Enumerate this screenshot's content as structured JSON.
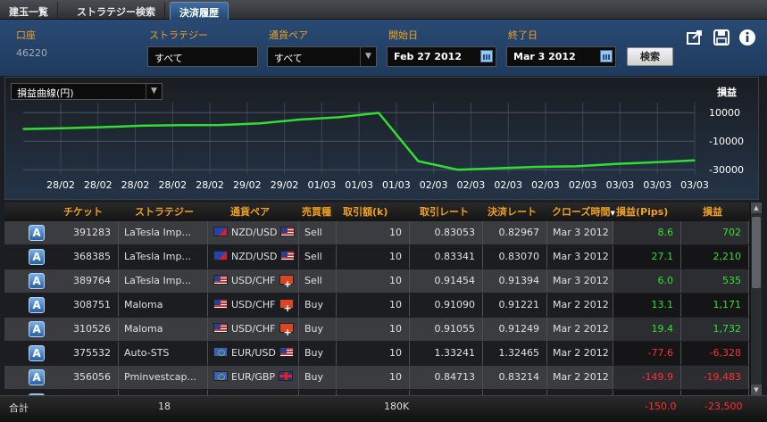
{
  "tabs": [
    {
      "label": "建玉一覧",
      "active": false
    },
    {
      "label": "ストラテジー検索",
      "active": false
    },
    {
      "label": "決済履歴",
      "active": true
    }
  ],
  "filter": {
    "account_label": "口座",
    "account_value": "46220",
    "strategy_label": "ストラテジー",
    "strategy_value": "すべて",
    "pair_label": "通貨ペア",
    "pair_value": "すべて",
    "start_label": "開始日",
    "start_value": "Feb 27 2012",
    "end_label": "終了日",
    "end_value": "Mar 3 2012",
    "search_button": "検索"
  },
  "toolbar_icons": [
    "export-icon",
    "save-icon",
    "info-icon"
  ],
  "chart_select": "損益曲線(円)",
  "chart_right_label": "損益",
  "chart_data": {
    "type": "line",
    "x": [
      "28/02",
      "28/02",
      "28/02",
      "28/02",
      "28/02",
      "29/02",
      "29/02",
      "01/03",
      "01/03",
      "01/03",
      "02/03",
      "02/03",
      "02/03",
      "02/03",
      "02/03",
      "03/03",
      "03/03",
      "03/03"
    ],
    "series": [
      {
        "values": [
          -1500,
          -1000,
          -200,
          800,
          1200,
          1300,
          2500,
          5100,
          6800,
          9800,
          -24000,
          -30000,
          -29000,
          -28000,
          -27600,
          -26000,
          -24800,
          -23500
        ]
      }
    ],
    "yticks": [
      10000,
      -10000,
      -30000
    ],
    "ylim": [
      -33000,
      17000
    ],
    "line_color": "#33dd33",
    "grid": true
  },
  "table": {
    "headers": [
      "チケット",
      "ストラテジー",
      "通貨ペア",
      "売買種",
      "取引額(k)",
      "取引レート",
      "決済レート",
      "クローズ時間",
      "損益(Pips)",
      "損益"
    ],
    "sort_column": "クローズ時間",
    "rows": [
      {
        "icon": "A",
        "ticket": "391283",
        "strategy": "LaTesla Imp...",
        "pair": "NZD/USD",
        "f1": "nzd",
        "f2": "usd",
        "side": "Sell",
        "amount": "10",
        "rate": "0.83053",
        "close_rate": "0.82967",
        "close_time": "Mar 3 2012",
        "pips": "8.6",
        "pnl": "702",
        "sign": "pos"
      },
      {
        "icon": "A",
        "ticket": "368385",
        "strategy": "LaTesla Imp...",
        "pair": "NZD/USD",
        "f1": "nzd",
        "f2": "usd",
        "side": "Sell",
        "amount": "10",
        "rate": "0.83341",
        "close_rate": "0.83070",
        "close_time": "Mar 3 2012",
        "pips": "27.1",
        "pnl": "2,210",
        "sign": "pos"
      },
      {
        "icon": "A",
        "ticket": "389764",
        "strategy": "LaTesla Imp...",
        "pair": "USD/CHF",
        "f1": "usd",
        "f2": "chf",
        "side": "Sell",
        "amount": "10",
        "rate": "0.91454",
        "close_rate": "0.91394",
        "close_time": "Mar 3 2012",
        "pips": "6.0",
        "pnl": "535",
        "sign": "pos"
      },
      {
        "icon": "A",
        "ticket": "308751",
        "strategy": "Maloma",
        "pair": "USD/CHF",
        "f1": "usd",
        "f2": "chf",
        "side": "Buy",
        "amount": "10",
        "rate": "0.91090",
        "close_rate": "0.91221",
        "close_time": "Mar 2 2012",
        "pips": "13.1",
        "pnl": "1,171",
        "sign": "pos"
      },
      {
        "icon": "A",
        "ticket": "310526",
        "strategy": "Maloma",
        "pair": "USD/CHF",
        "f1": "usd",
        "f2": "chf",
        "side": "Buy",
        "amount": "10",
        "rate": "0.91055",
        "close_rate": "0.91249",
        "close_time": "Mar 2 2012",
        "pips": "19.4",
        "pnl": "1,732",
        "sign": "pos"
      },
      {
        "icon": "A",
        "ticket": "375532",
        "strategy": "Auto-STS",
        "pair": "EUR/USD",
        "f1": "eur",
        "f2": "usd",
        "side": "Buy",
        "amount": "10",
        "rate": "1.33241",
        "close_rate": "1.32465",
        "close_time": "Mar 2 2012",
        "pips": "-77.6",
        "pnl": "-6,328",
        "sign": "neg"
      },
      {
        "icon": "A",
        "ticket": "356056",
        "strategy": "Pminvestcap...",
        "pair": "EUR/GBP",
        "f1": "eur",
        "f2": "gbp",
        "side": "Buy",
        "amount": "10",
        "rate": "0.84713",
        "close_rate": "0.83214",
        "close_time": "Mar 2 2012",
        "pips": "-149.9",
        "pnl": "-19,483",
        "sign": "neg"
      },
      {
        "icon": "A",
        "ticket": "",
        "strategy": "",
        "pair": "",
        "f1": "",
        "f2": "",
        "side": "",
        "amount": "",
        "rate": "",
        "close_rate": "",
        "close_time": "",
        "pips": "",
        "pnl": "",
        "sign": "pos"
      }
    ]
  },
  "footer": {
    "total_label": "合計",
    "count": "18",
    "amount": "180K",
    "pips": "-150.0",
    "pnl": "-23,500"
  }
}
